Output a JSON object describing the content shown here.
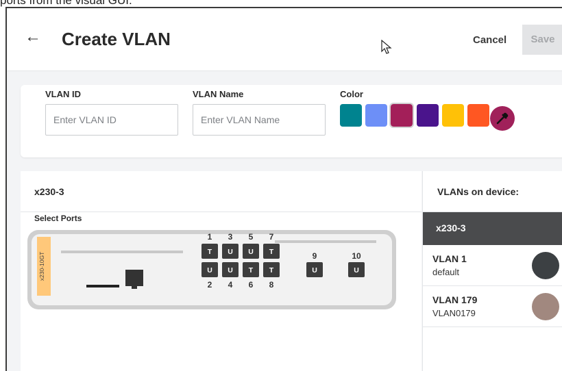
{
  "caption": "ports from the visual GUI.",
  "header": {
    "title": "Create VLAN",
    "cancel_label": "Cancel",
    "save_label": "Save"
  },
  "form": {
    "vlan_id": {
      "label": "VLAN ID",
      "placeholder": "Enter VLAN ID",
      "value": ""
    },
    "vlan_name": {
      "label": "VLAN Name",
      "placeholder": "Enter VLAN Name",
      "value": ""
    },
    "color": {
      "label": "Color",
      "swatches": [
        "#00838f",
        "#6d8ff7",
        "#a31f59",
        "#4a148c",
        "#ffc107",
        "#ff5722"
      ],
      "selected_index": 2
    }
  },
  "device_panel": {
    "title": "x230-3",
    "select_ports_label": "Select Ports",
    "model_label": "x230-10GT",
    "top_port_numbers": [
      "1",
      "3",
      "5",
      "7"
    ],
    "bottom_port_numbers": [
      "2",
      "4",
      "6",
      "8"
    ],
    "top_port_modes": [
      "T",
      "U",
      "U",
      "T"
    ],
    "bottom_port_modes": [
      "U",
      "U",
      "T",
      "T"
    ],
    "uplink_numbers": [
      "9",
      "10"
    ],
    "uplink_modes": [
      "U",
      "U"
    ]
  },
  "vlans_panel": {
    "title": "VLANs on device:",
    "device_name": "x230-3",
    "vlans": [
      {
        "name": "VLAN 1",
        "description": "default",
        "color": "#3c4043"
      },
      {
        "name": "VLAN 179",
        "description": "VLAN0179",
        "color": "#a1887f"
      }
    ]
  }
}
